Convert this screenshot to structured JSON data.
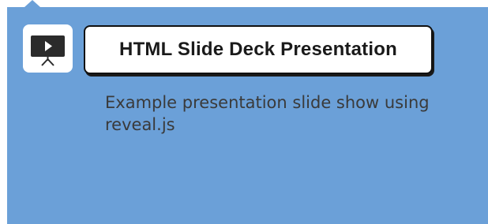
{
  "card": {
    "title": "HTML Slide Deck Presentation",
    "description": "Example presentation slide show using reveal.js",
    "icon": "presentation-screen-icon"
  },
  "colors": {
    "panel_background": "#6ba0d8",
    "icon_tile": "#ffffff",
    "button_background": "#ffffff",
    "text_dark": "#1a1a1a",
    "description_text": "#3a3a3a"
  }
}
